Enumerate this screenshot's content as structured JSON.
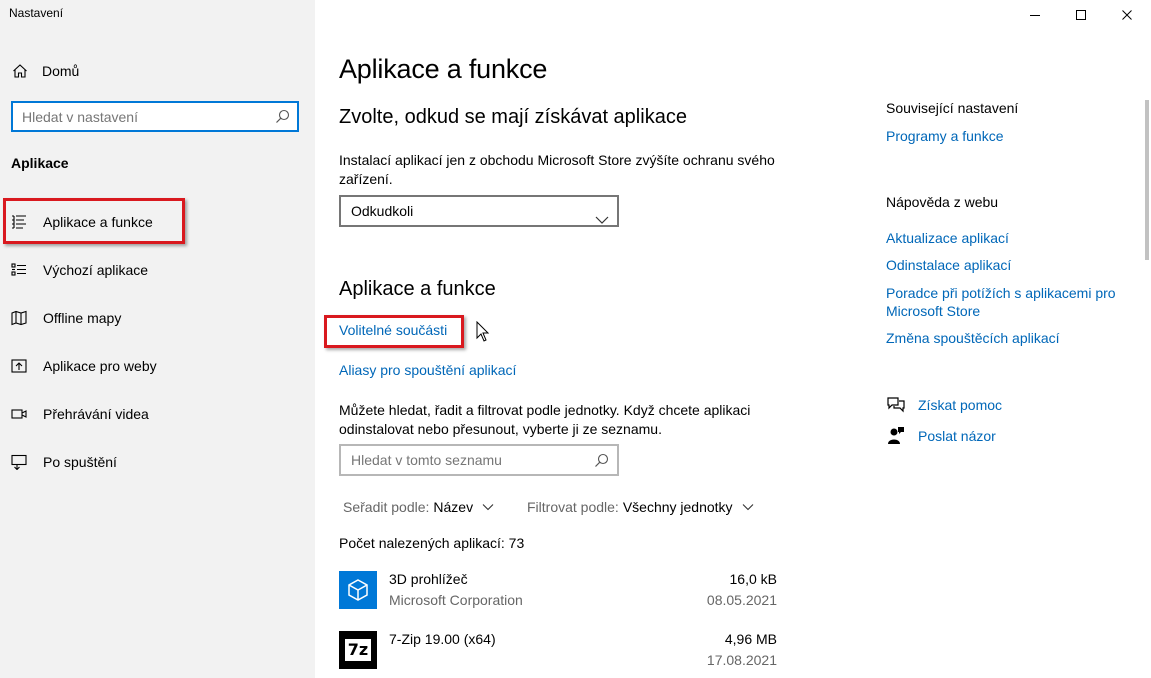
{
  "window": {
    "title": "Nastavení",
    "minimize_label": "minimize",
    "maximize_label": "maximize",
    "close_label": "close"
  },
  "sidebar": {
    "home_label": "Domů",
    "search_placeholder": "Hledat v nastavení",
    "section_label": "Aplikace",
    "items": [
      {
        "label": "Aplikace a funkce",
        "icon": "apps-features-icon",
        "active": true
      },
      {
        "label": "Výchozí aplikace",
        "icon": "default-apps-icon",
        "active": false
      },
      {
        "label": "Offline mapy",
        "icon": "map-icon",
        "active": false
      },
      {
        "label": "Aplikace pro weby",
        "icon": "apps-for-websites-icon",
        "active": false
      },
      {
        "label": "Přehrávání videa",
        "icon": "video-icon",
        "active": false
      },
      {
        "label": "Po spuštění",
        "icon": "startup-icon",
        "active": false
      }
    ]
  },
  "main": {
    "title": "Aplikace a funkce",
    "source_heading": "Zvolte, odkud se mají získávat aplikace",
    "source_description": "Instalací aplikací jen z obchodu Microsoft Store zvýšíte ochranu svého zařízení.",
    "source_value": "Odkudkoli",
    "apps_heading": "Aplikace a funkce",
    "optional_features_link": "Volitelné součásti",
    "aliases_link": "Aliasy pro spouštění aplikací",
    "apps_description": "Můžete hledat, řadit a filtrovat podle jednotky. Když chcete aplikaci odinstalovat nebo přesunout, vyberte ji ze seznamu.",
    "list_search_placeholder": "Hledat v tomto seznamu",
    "sort_label": "Seřadit podle:",
    "sort_value": "Název",
    "filter_label": "Filtrovat podle:",
    "filter_value": "Všechny jednotky",
    "count_text": "Počet nalezených aplikací: 73",
    "apps": [
      {
        "name": "3D prohlížeč",
        "publisher": "Microsoft Corporation",
        "size": "16,0 kB",
        "date": "08.05.2021",
        "icon": "3d-viewer-icon",
        "icon_color": "#0078d7"
      },
      {
        "name": "7-Zip 19.00 (x64)",
        "publisher": "",
        "size": "4,96 MB",
        "date": "17.08.2021",
        "icon": "7zip-icon",
        "icon_color": "#000000",
        "icon_text": "7z"
      }
    ]
  },
  "related": {
    "heading": "Související nastavení",
    "programs_link": "Programy a funkce",
    "web_help_heading": "Nápověda z webu",
    "web_links": [
      "Aktualizace aplikací",
      "Odinstalace aplikací",
      "Poradce při potížích s aplikacemi pro Microsoft Store",
      "Změna spouštěcích aplikací"
    ],
    "get_help": "Získat pomoc",
    "feedback": "Poslat názor"
  },
  "colors": {
    "accent": "#0078d7",
    "link": "#0067b8",
    "highlight_box": "#d9191f",
    "sidebar_bg": "#f2f2f2"
  }
}
